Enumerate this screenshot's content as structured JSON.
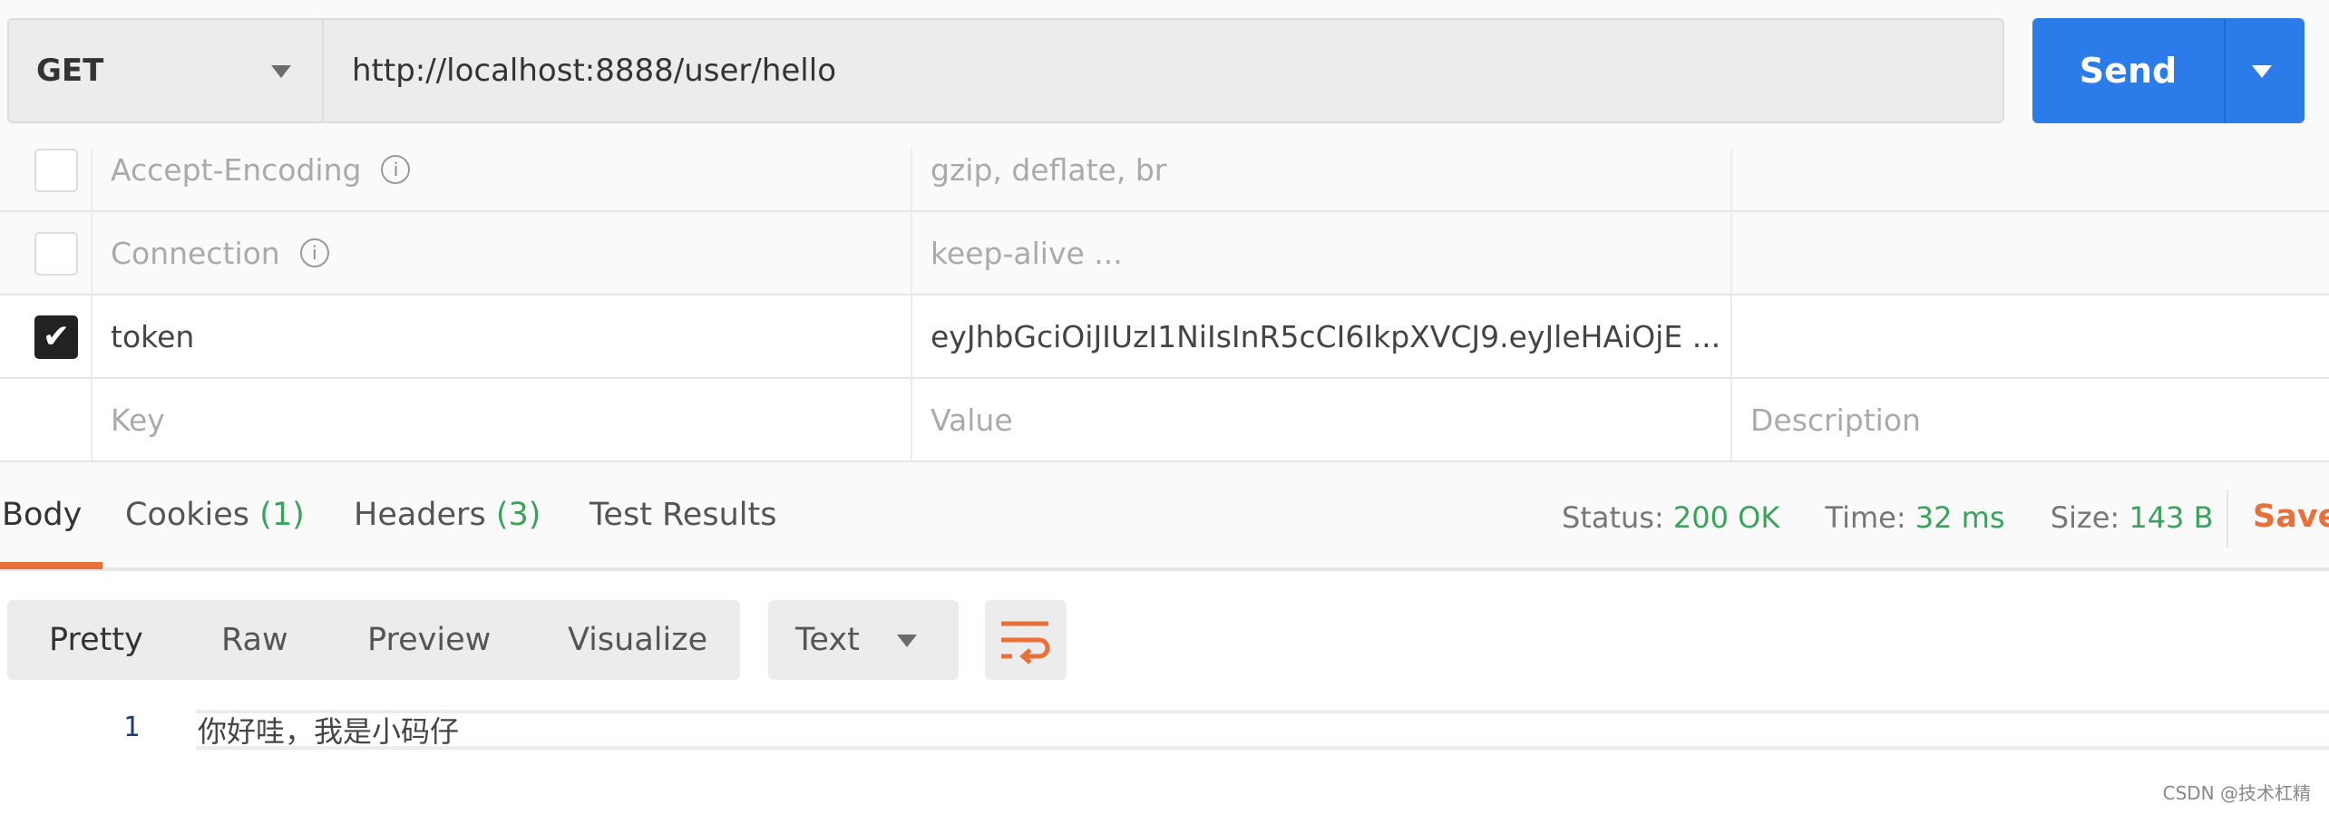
{
  "request": {
    "method": "GET",
    "url": "http://localhost:8888/user/hello",
    "send_label": "Send"
  },
  "headers": [
    {
      "checked": false,
      "key": "Accept-Encoding",
      "value": "gzip, deflate, br",
      "info": "i"
    },
    {
      "checked": false,
      "key": "Connection",
      "value": "keep-alive ...",
      "info": "i"
    },
    {
      "checked": true,
      "key": "token",
      "value": "eyJhbGciOiJIUzI1NiIsInR5cCI6IkpXVCJ9.eyJleHAiOjE ..."
    }
  ],
  "placeholders": {
    "key": "Key",
    "value": "Value",
    "description": "Description"
  },
  "response": {
    "tabs": [
      {
        "label": "Body"
      },
      {
        "label": "Cookies",
        "count": "(1)"
      },
      {
        "label": "Headers",
        "count": "(3)"
      },
      {
        "label": "Test Results"
      }
    ],
    "status_label": "Status:",
    "status": "200 OK",
    "time_label": "Time:",
    "time": "32 ms",
    "size_label": "Size:",
    "size": "143 B",
    "save_label": "Save",
    "view_modes": [
      "Pretty",
      "Raw",
      "Preview",
      "Visualize"
    ],
    "format": "Text",
    "body_lines": [
      {
        "n": "1",
        "text": "你好哇，我是小码仔"
      }
    ]
  },
  "watermark": "CSDN @技术杠精",
  "colors": {
    "accent": "#2b7be8",
    "orange": "#e8703a",
    "green": "#3aa35b"
  }
}
